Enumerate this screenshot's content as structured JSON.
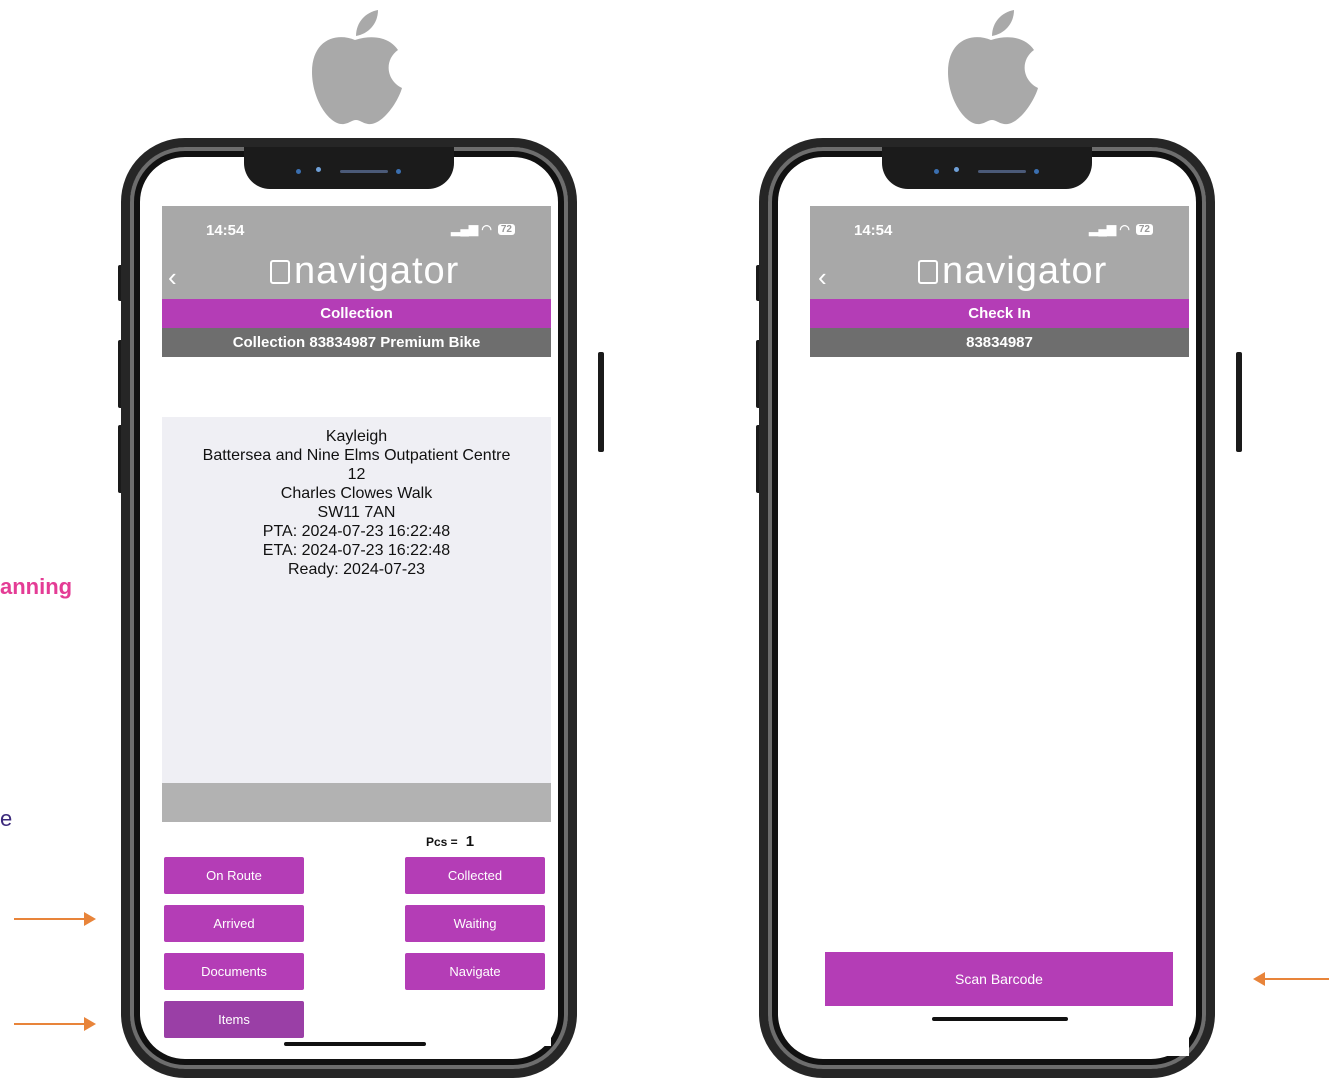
{
  "side_text": {
    "pink_fragment": "anning",
    "purple_fragment": "e"
  },
  "colors": {
    "brand_purple": "#b43db6",
    "header_grey": "#a8a8a8",
    "subheader_grey": "#6e6e6e",
    "arrow_orange": "#e8843a",
    "accent_pink": "#e43c95"
  },
  "left_phone": {
    "status_time": "14:54",
    "status_icons": "▂▄▆ ◠",
    "battery": "72",
    "logo_text": "navigator",
    "back_icon": "chevron-left-icon",
    "title": "Collection",
    "subtitle": "Collection 83834987 Premium Bike",
    "address": {
      "name": "Kayleigh",
      "place": "Battersea and Nine Elms Outpatient Centre",
      "number": "12",
      "street": "Charles Clowes Walk",
      "postcode": "SW11 7AN",
      "pta": "PTA: 2024-07-23 16:22:48",
      "eta": "ETA: 2024-07-23 16:22:48",
      "ready": "Ready: 2024-07-23"
    },
    "pcs_label": "Pcs =",
    "pcs_value": "1",
    "buttons": {
      "on_route": "On Route",
      "collected": "Collected",
      "arrived": "Arrived",
      "waiting": "Waiting",
      "documents": "Documents",
      "navigate": "Navigate",
      "items": "Items"
    }
  },
  "right_phone": {
    "status_time": "14:54",
    "status_icons": "▂▄▆ ◠",
    "battery": "72",
    "logo_text": "navigator",
    "back_icon": "chevron-left-icon",
    "title": "Check In",
    "subtitle": "83834987",
    "scan_button": "Scan Barcode"
  }
}
